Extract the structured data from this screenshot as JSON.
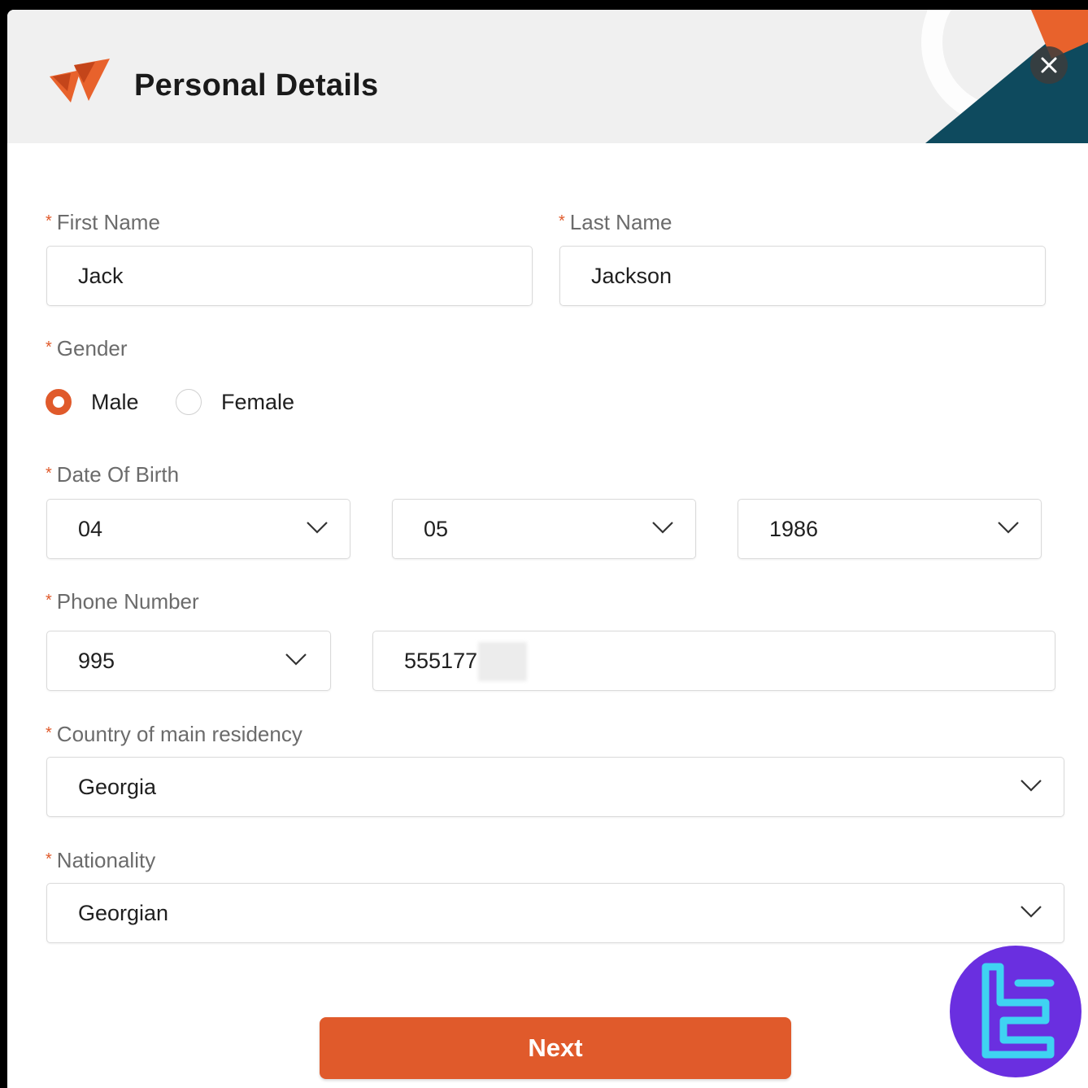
{
  "header": {
    "title": "Personal Details"
  },
  "form": {
    "first_name": {
      "label": "First Name",
      "value": "Jack"
    },
    "last_name": {
      "label": "Last Name",
      "value": "Jackson"
    },
    "gender": {
      "label": "Gender",
      "options": [
        "Male",
        "Female"
      ],
      "selected": "Male"
    },
    "dob": {
      "label": "Date Of Birth",
      "day": "04",
      "month": "05",
      "year": "1986"
    },
    "phone": {
      "label": "Phone Number",
      "code": "995",
      "number": "555177"
    },
    "country": {
      "label": "Country of main residency",
      "value": "Georgia"
    },
    "nationality": {
      "label": "Nationality",
      "value": "Georgian"
    },
    "required_marker": "*"
  },
  "actions": {
    "next_label": "Next"
  },
  "colors": {
    "accent": "#e05a2b",
    "header_bg": "#f0f0f0",
    "header_teal": "#0e4a5e",
    "watermark": "#6a2fe0",
    "watermark_glyph": "#3fd3f2"
  },
  "icons": {
    "close": "close-icon",
    "chevron": "chevron-down-icon",
    "logo": "brand-logo-icon",
    "watermark": "watermark-logo-icon"
  }
}
